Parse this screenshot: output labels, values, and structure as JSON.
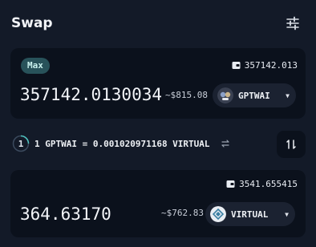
{
  "header": {
    "title": "Swap",
    "settings_icon": "sliders-icon"
  },
  "from": {
    "max_label": "Max",
    "balance": "357142.013",
    "amount": "357142.0130034",
    "usd_value": "~$815.08",
    "token": "GPTWAI",
    "token_icon": "gptwai-logo"
  },
  "rate": {
    "text": "1 GPTWAI = 0.001020971168 VIRTUAL",
    "timer_value": "1",
    "refresh_icon": "refresh-icon"
  },
  "switch_icon": "swap-arrows-icon",
  "to": {
    "balance": "3541.655415",
    "amount": "364.63170",
    "usd_value": "~$762.83",
    "token": "VIRTUAL",
    "token_icon": "virtual-logo"
  },
  "colors": {
    "background": "#131a28",
    "panel": "#0b111c",
    "max_badge": "#28525a",
    "timer_accent": "#4fc3c0"
  }
}
